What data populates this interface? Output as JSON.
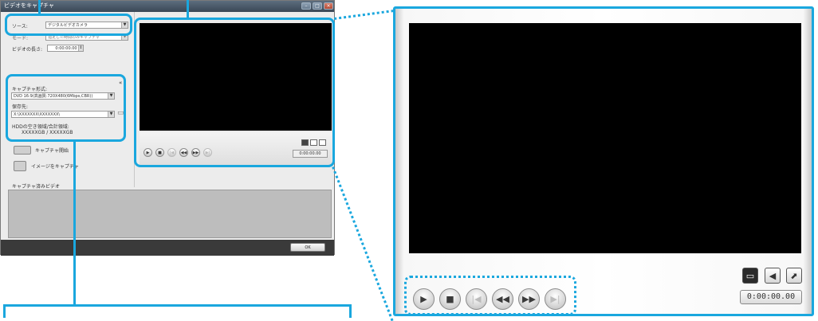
{
  "dialog": {
    "title": "ビデオをキャプチャ",
    "source_label": "ソース:",
    "source_value": "デジタルビデオカメラ",
    "mode_label": "モード:",
    "mode_value": "指定した時間のみキャプチャ",
    "length_label": "ビデオの長さ:",
    "length_value": "0:00:00.00",
    "capture_format_label": "キャプチャ形式:",
    "capture_format_value": "DVD 16:9(高画質:720X480(6Mbps,CBR))",
    "save_to_label": "保存先:",
    "save_to_value": "X:\\XXXXXXX\\XXXXXXX\\",
    "hdd_label": "HDDの空き領域/合計領域:",
    "hdd_value": "XXXXXGB / XXXXXGB",
    "start_capture_label": "キャプチャ開始",
    "capture_image_label": "イメージをキャプチャ",
    "captured_video_label": "キャプチャ済みビデオ",
    "ok_label": "OK",
    "small_time": "0:00:00.00"
  },
  "preview": {
    "time": "0:00:00.00",
    "buttons": [
      {
        "name": "play-button",
        "glyph": "▶",
        "enabled": true
      },
      {
        "name": "stop-button",
        "glyph": "■",
        "enabled": true
      },
      {
        "name": "previous-button",
        "glyph": "|◀",
        "enabled": false
      },
      {
        "name": "rewind-button",
        "glyph": "◀◀",
        "enabled": true
      },
      {
        "name": "fast-forward-button",
        "glyph": "▶▶",
        "enabled": true
      },
      {
        "name": "next-button",
        "glyph": "▶|",
        "enabled": false
      }
    ],
    "accent_color": "#1aa7de"
  }
}
